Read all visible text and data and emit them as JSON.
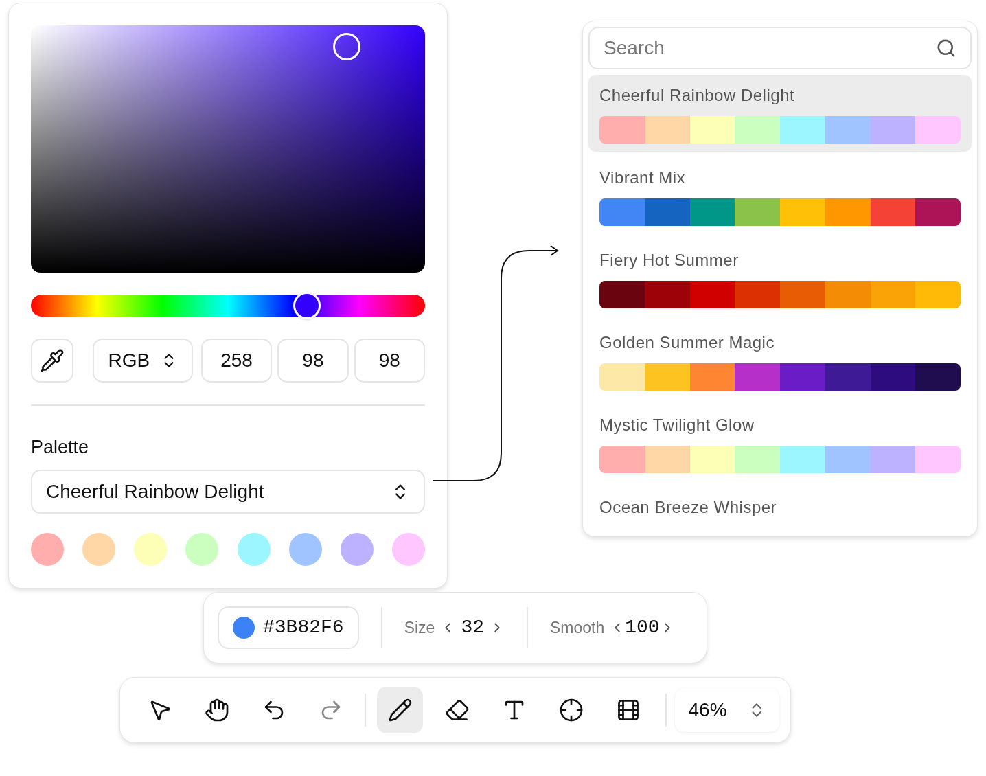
{
  "color_picker": {
    "hue_slider": {
      "level": 0.7
    },
    "eyedropper": {
      "kind": "eyedropper"
    },
    "mode": "RGB",
    "values": [
      "258",
      "98",
      "98"
    ],
    "palette_label": "Palette",
    "palette_select": "Cheerful Rainbow Delight",
    "swatches": [
      {
        "color": "#ffadad"
      },
      {
        "color": "#ffd6a5"
      },
      {
        "color": "#fdffb6"
      },
      {
        "color": "#caffbf"
      },
      {
        "color": "#9bf6ff"
      },
      {
        "color": "#a0c4ff"
      },
      {
        "color": "#bdb2ff"
      },
      {
        "color": "#ffc6ff"
      }
    ]
  },
  "palette_list": {
    "search": {
      "placeholder": "Search"
    },
    "items": [
      {
        "name": "Cheerful Rainbow Delight",
        "selected": true,
        "colors": [
          {
            "color": "#ffadad"
          },
          {
            "color": "#ffd6a5"
          },
          {
            "color": "#fdffb6"
          },
          {
            "color": "#caffbf"
          },
          {
            "color": "#9bf6ff"
          },
          {
            "color": "#a0c4ff"
          },
          {
            "color": "#bdb2ff"
          },
          {
            "color": "#ffc6ff"
          }
        ]
      },
      {
        "name": "Vibrant Mix",
        "selected": false,
        "colors": [
          {
            "color": "#4285f4"
          },
          {
            "color": "#1565c0"
          },
          {
            "color": "#009688"
          },
          {
            "color": "#8bc34a"
          },
          {
            "color": "#ffc107"
          },
          {
            "color": "#ff9800"
          },
          {
            "color": "#f44336"
          },
          {
            "color": "#ad1457"
          }
        ]
      },
      {
        "name": "Fiery Hot Summer",
        "selected": false,
        "colors": [
          {
            "color": "#6a040f"
          },
          {
            "color": "#9d0208"
          },
          {
            "color": "#d00000"
          },
          {
            "color": "#dc2f02"
          },
          {
            "color": "#e85d04"
          },
          {
            "color": "#f48c06"
          },
          {
            "color": "#faa307"
          },
          {
            "color": "#ffba08"
          }
        ]
      },
      {
        "name": "Golden Summer Magic",
        "selected": false,
        "colors": [
          {
            "color": "#fde8a8"
          },
          {
            "color": "#fdc421"
          },
          {
            "color": "#fe8633"
          },
          {
            "color": "#b52fc8"
          },
          {
            "color": "#6a1dc6"
          },
          {
            "color": "#3f1a96"
          },
          {
            "color": "#2c0c7e"
          },
          {
            "color": "#200d50"
          }
        ]
      },
      {
        "name": "Mystic Twilight Glow",
        "selected": false,
        "colors": [
          {
            "color": "#ffadad"
          },
          {
            "color": "#ffd6a5"
          },
          {
            "color": "#fdffb6"
          },
          {
            "color": "#caffbf"
          },
          {
            "color": "#9bf6ff"
          },
          {
            "color": "#a0c4ff"
          },
          {
            "color": "#bdb2ff"
          },
          {
            "color": "#ffc6ff"
          }
        ]
      },
      {
        "name": "Ocean Breeze Whisper",
        "selected": false
      }
    ]
  },
  "brush_bar": {
    "color": {
      "color": "#3b82f6",
      "label": "#3B82F6"
    },
    "size": {
      "label": "Size",
      "value": "32"
    },
    "smooth": {
      "label": "Smooth",
      "value": "100"
    }
  },
  "toolbar": {
    "tools": [
      {
        "kind": "select",
        "selected": false,
        "disabled": false
      },
      {
        "kind": "hand",
        "selected": false,
        "disabled": false
      },
      {
        "kind": "undo",
        "selected": false,
        "disabled": false
      },
      {
        "kind": "redo",
        "selected": false,
        "disabled": true
      },
      {
        "kind": "pencil",
        "selected": true,
        "disabled": false
      },
      {
        "kind": "eraser",
        "selected": false,
        "disabled": false
      },
      {
        "kind": "text",
        "selected": false,
        "disabled": false
      },
      {
        "kind": "crosshair",
        "selected": false,
        "disabled": false
      },
      {
        "kind": "film",
        "selected": false,
        "disabled": false
      }
    ],
    "zoom": "46%"
  }
}
